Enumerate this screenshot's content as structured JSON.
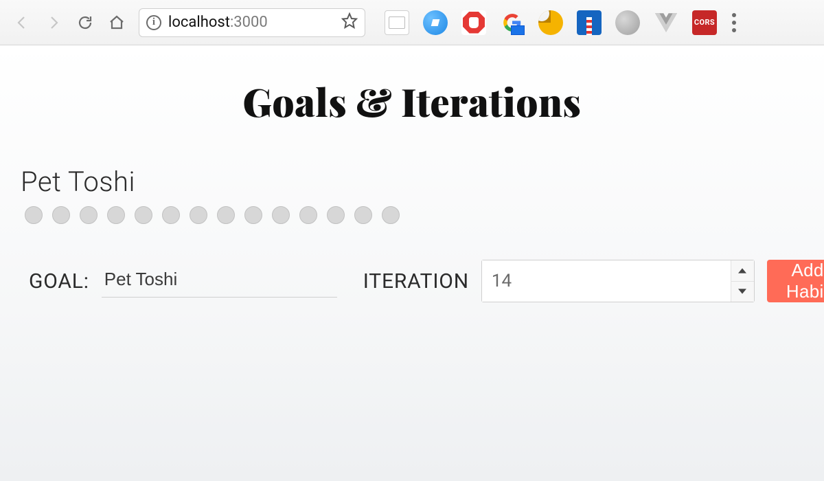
{
  "browser": {
    "url_host": "localhost",
    "url_port": ":3000"
  },
  "page": {
    "title": "Goals & Iterations"
  },
  "habit": {
    "name": "Pet Toshi",
    "dot_count": 14
  },
  "form": {
    "goal_label": "GOAL:",
    "goal_value": "Pet Toshi",
    "iteration_label": "ITERATION",
    "iteration_value": "14",
    "add_button_label": "Add Habit"
  },
  "colors": {
    "accent": "#ff6b57"
  }
}
